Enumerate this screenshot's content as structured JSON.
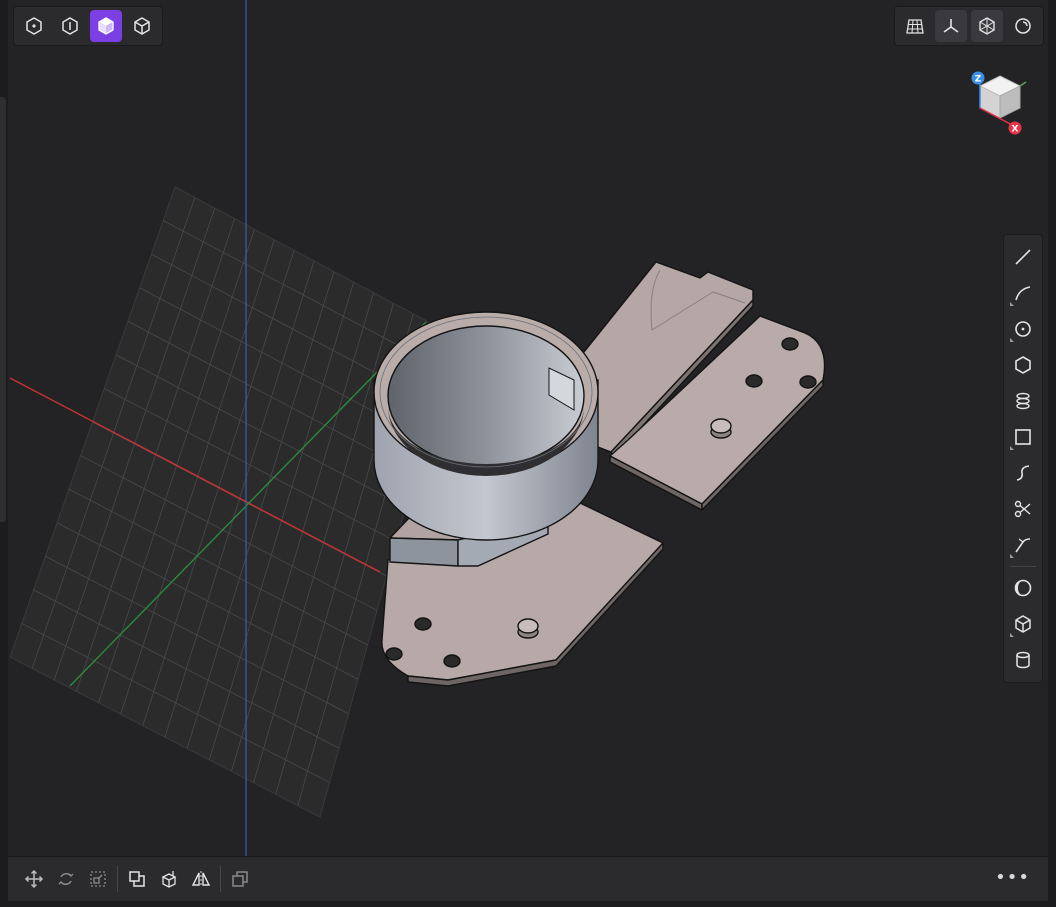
{
  "view_modes": [
    {
      "name": "points-view-icon",
      "active": false
    },
    {
      "name": "wireframe-view-icon",
      "active": false
    },
    {
      "name": "shaded-view-icon",
      "active": true
    },
    {
      "name": "hidden-line-view-icon",
      "active": false
    }
  ],
  "display_toggles": [
    {
      "name": "grid-toggle-icon",
      "active": false
    },
    {
      "name": "axes-toggle-icon",
      "active": true
    },
    {
      "name": "xray-toggle-icon",
      "active": true
    },
    {
      "name": "lighting-toggle-icon",
      "active": false
    }
  ],
  "orientation_gizmo": {
    "z_label": "Z",
    "x_label": "X",
    "z_color": "#3a8ee6",
    "x_color": "#e6334a"
  },
  "sketch_tools": [
    "line-tool-icon",
    "arc-tool-icon",
    "circle-tool-icon",
    "polygon-tool-icon",
    "pattern-tool-icon",
    "rectangle-tool-icon",
    "spline-tool-icon",
    "trim-tool-icon",
    "fillet-sketch-tool-icon"
  ],
  "solid_tools": [
    "shell-tool-icon",
    "box-tool-icon",
    "cylinder-tool-icon"
  ],
  "transform_tools": [
    "move-icon",
    "rotate-icon",
    "scale-icon"
  ],
  "edit_tools": [
    "offset-icon",
    "extrude-face-icon",
    "mirror-icon"
  ],
  "copy_tool": "duplicate-icon",
  "more_label": "•••",
  "colors": {
    "accent": "#7b3fe4",
    "x_axis": "#c83232",
    "y_axis": "#2c8a3c",
    "z_axis": "#3a5fa8",
    "part": "#b2a5a3",
    "cup": "#a3a9b6"
  }
}
